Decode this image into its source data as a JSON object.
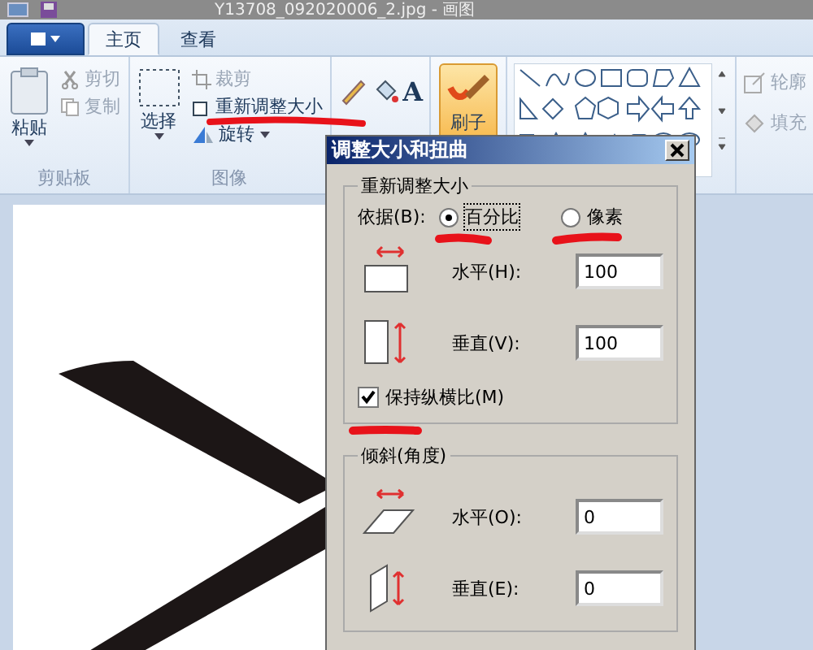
{
  "window": {
    "title": "Y13708_092020006_2.jpg - 画图"
  },
  "tabs": [
    {
      "label": "主页",
      "selected": true
    },
    {
      "label": "查看",
      "selected": false
    }
  ],
  "ribbon": {
    "clipboard": {
      "paste": "粘贴",
      "cut": "剪切",
      "copy": "复制",
      "label": "剪贴板"
    },
    "image": {
      "select": "选择",
      "crop": "裁剪",
      "resize": "重新调整大小",
      "rotate": "旋转",
      "label": "图像"
    },
    "text_tool": "A",
    "brush": "刷子",
    "outline": "轮廓",
    "fill": "填充"
  },
  "dialog": {
    "title": "调整大小和扭曲",
    "resize": {
      "title": "重新调整大小",
      "by_label": "依据(B):",
      "options": [
        {
          "label": "百分比",
          "selected": true
        },
        {
          "label": "像素",
          "selected": false
        }
      ],
      "horizontal": {
        "label": "水平(H):",
        "value": "100"
      },
      "vertical": {
        "label": "垂直(V):",
        "value": "100"
      },
      "keep_ratio": {
        "label": "保持纵横比(M)",
        "checked": true
      }
    },
    "skew": {
      "title": "倾斜(角度)",
      "horizontal": {
        "label": "水平(O):",
        "value": "0"
      },
      "vertical": {
        "label": "垂直(E):",
        "value": "0"
      }
    }
  }
}
